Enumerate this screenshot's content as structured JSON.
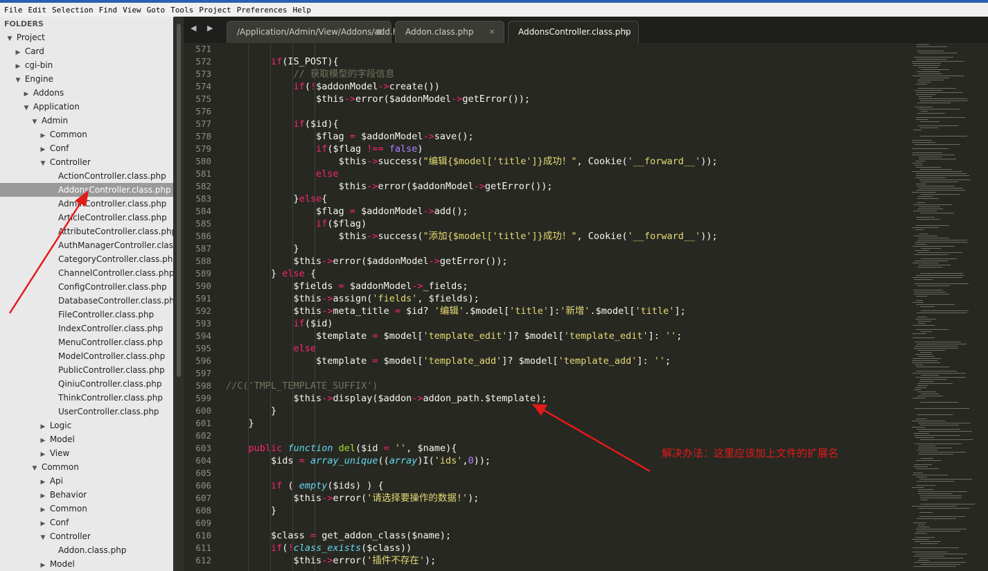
{
  "menu": [
    "File",
    "Edit",
    "Selection",
    "Find",
    "View",
    "Goto",
    "Tools",
    "Project",
    "Preferences",
    "Help"
  ],
  "sidebar": {
    "header": "FOLDERS",
    "tree": [
      {
        "label": "Project",
        "depth": 0,
        "open": true
      },
      {
        "label": "Card",
        "depth": 1,
        "open": false
      },
      {
        "label": "cgi-bin",
        "depth": 1,
        "open": false
      },
      {
        "label": "Engine",
        "depth": 1,
        "open": true
      },
      {
        "label": "Addons",
        "depth": 2,
        "open": false
      },
      {
        "label": "Application",
        "depth": 2,
        "open": true
      },
      {
        "label": "Admin",
        "depth": 3,
        "open": true
      },
      {
        "label": "Common",
        "depth": 4,
        "open": false
      },
      {
        "label": "Conf",
        "depth": 4,
        "open": false
      },
      {
        "label": "Controller",
        "depth": 4,
        "open": true
      },
      {
        "label": "ActionController.class.php",
        "depth": 5,
        "file": true
      },
      {
        "label": "AddonsController.class.php",
        "depth": 5,
        "file": true,
        "selected": true
      },
      {
        "label": "AdminController.class.php",
        "depth": 5,
        "file": true
      },
      {
        "label": "ArticleController.class.php",
        "depth": 5,
        "file": true
      },
      {
        "label": "AttributeController.class.php",
        "depth": 5,
        "file": true
      },
      {
        "label": "AuthManagerController.class.php",
        "depth": 5,
        "file": true
      },
      {
        "label": "CategoryController.class.php",
        "depth": 5,
        "file": true
      },
      {
        "label": "ChannelController.class.php",
        "depth": 5,
        "file": true
      },
      {
        "label": "ConfigController.class.php",
        "depth": 5,
        "file": true
      },
      {
        "label": "DatabaseController.class.php",
        "depth": 5,
        "file": true
      },
      {
        "label": "FileController.class.php",
        "depth": 5,
        "file": true
      },
      {
        "label": "IndexController.class.php",
        "depth": 5,
        "file": true
      },
      {
        "label": "MenuController.class.php",
        "depth": 5,
        "file": true
      },
      {
        "label": "ModelController.class.php",
        "depth": 5,
        "file": true
      },
      {
        "label": "PublicController.class.php",
        "depth": 5,
        "file": true
      },
      {
        "label": "QiniuController.class.php",
        "depth": 5,
        "file": true
      },
      {
        "label": "ThinkController.class.php",
        "depth": 5,
        "file": true
      },
      {
        "label": "UserController.class.php",
        "depth": 5,
        "file": true
      },
      {
        "label": "Logic",
        "depth": 4,
        "open": false
      },
      {
        "label": "Model",
        "depth": 4,
        "open": false
      },
      {
        "label": "View",
        "depth": 4,
        "open": false
      },
      {
        "label": "Common",
        "depth": 3,
        "open": true
      },
      {
        "label": "Api",
        "depth": 4,
        "open": false
      },
      {
        "label": "Behavior",
        "depth": 4,
        "open": false
      },
      {
        "label": "Common",
        "depth": 4,
        "open": false
      },
      {
        "label": "Conf",
        "depth": 4,
        "open": false
      },
      {
        "label": "Controller",
        "depth": 4,
        "open": true
      },
      {
        "label": "Addon.class.php",
        "depth": 5,
        "file": true
      },
      {
        "label": "Model",
        "depth": 4,
        "open": false
      }
    ]
  },
  "tabs": [
    {
      "label": "/Application/Admin/View/Addons/add.html",
      "marker": "●",
      "active": false
    },
    {
      "label": "Addon.class.php",
      "marker": "×",
      "active": false
    },
    {
      "label": "AddonsController.class.php",
      "marker": "×",
      "active": true
    }
  ],
  "nav_arrows": "◀ ▶",
  "colors": {
    "keyword": "#f92672",
    "string": "#e6db74",
    "func": "#66d9ef",
    "call": "#a6e22e",
    "comment": "#75715e",
    "number": "#ae81ff",
    "plain": "#f8f8f2",
    "annotation": "#e21a1a"
  },
  "code": [
    {
      "n": "571",
      "t": []
    },
    {
      "n": "572",
      "t": [
        [
          "        ",
          "p"
        ],
        [
          "if",
          "k"
        ],
        [
          "(IS_POST){",
          "p"
        ]
      ]
    },
    {
      "n": "573",
      "t": [
        [
          "            ",
          "p"
        ],
        [
          "// 获取模型的字段信息",
          "c"
        ]
      ]
    },
    {
      "n": "574",
      "t": [
        [
          "            ",
          "p"
        ],
        [
          "if",
          "k"
        ],
        [
          "(",
          "p"
        ],
        [
          "!",
          "k"
        ],
        [
          "$addonModel",
          "p"
        ],
        [
          "->",
          "k"
        ],
        [
          "create",
          "p"
        ],
        [
          "())",
          "p"
        ]
      ]
    },
    {
      "n": "575",
      "t": [
        [
          "                ",
          "p"
        ],
        [
          "$this",
          "p"
        ],
        [
          "->",
          "k"
        ],
        [
          "error",
          "p"
        ],
        [
          "($addonModel",
          "p"
        ],
        [
          "->",
          "k"
        ],
        [
          "getError",
          "p"
        ],
        [
          "());",
          "p"
        ]
      ]
    },
    {
      "n": "576",
      "t": []
    },
    {
      "n": "577",
      "t": [
        [
          "            ",
          "p"
        ],
        [
          "if",
          "k"
        ],
        [
          "($id){",
          "p"
        ]
      ]
    },
    {
      "n": "578",
      "t": [
        [
          "                ",
          "p"
        ],
        [
          "$flag ",
          "p"
        ],
        [
          "=",
          "k"
        ],
        [
          " $addonModel",
          "p"
        ],
        [
          "->",
          "k"
        ],
        [
          "save",
          "p"
        ],
        [
          "();",
          "p"
        ]
      ]
    },
    {
      "n": "579",
      "t": [
        [
          "                ",
          "p"
        ],
        [
          "if",
          "k"
        ],
        [
          "($flag ",
          "p"
        ],
        [
          "!==",
          "k"
        ],
        [
          " ",
          "p"
        ],
        [
          "false",
          "n"
        ],
        [
          ")",
          "p"
        ]
      ]
    },
    {
      "n": "580",
      "t": [
        [
          "                    ",
          "p"
        ],
        [
          "$this",
          "p"
        ],
        [
          "->",
          "k"
        ],
        [
          "success",
          "p"
        ],
        [
          "(",
          "p"
        ],
        [
          "\"编辑{$model['title']}成功！\"",
          "s"
        ],
        [
          ", Cookie(",
          "p"
        ],
        [
          "'__forward__'",
          "s"
        ],
        [
          "));",
          "p"
        ]
      ]
    },
    {
      "n": "581",
      "t": [
        [
          "                ",
          "p"
        ],
        [
          "else",
          "k"
        ]
      ]
    },
    {
      "n": "582",
      "t": [
        [
          "                    ",
          "p"
        ],
        [
          "$this",
          "p"
        ],
        [
          "->",
          "k"
        ],
        [
          "error",
          "p"
        ],
        [
          "($addonModel",
          "p"
        ],
        [
          "->",
          "k"
        ],
        [
          "getError",
          "p"
        ],
        [
          "());",
          "p"
        ]
      ]
    },
    {
      "n": "583",
      "t": [
        [
          "            ",
          "p"
        ],
        [
          "}",
          "p"
        ],
        [
          "else",
          "k"
        ],
        [
          "{",
          "p"
        ]
      ]
    },
    {
      "n": "584",
      "t": [
        [
          "                ",
          "p"
        ],
        [
          "$flag ",
          "p"
        ],
        [
          "=",
          "k"
        ],
        [
          " $addonModel",
          "p"
        ],
        [
          "->",
          "k"
        ],
        [
          "add",
          "p"
        ],
        [
          "();",
          "p"
        ]
      ]
    },
    {
      "n": "585",
      "t": [
        [
          "                ",
          "p"
        ],
        [
          "if",
          "k"
        ],
        [
          "($flag)",
          "p"
        ]
      ]
    },
    {
      "n": "586",
      "t": [
        [
          "                    ",
          "p"
        ],
        [
          "$this",
          "p"
        ],
        [
          "->",
          "k"
        ],
        [
          "success",
          "p"
        ],
        [
          "(",
          "p"
        ],
        [
          "\"添加{$model['title']}成功！\"",
          "s"
        ],
        [
          ", Cookie(",
          "p"
        ],
        [
          "'__forward__'",
          "s"
        ],
        [
          "));",
          "p"
        ]
      ]
    },
    {
      "n": "587",
      "t": [
        [
          "            ",
          "p"
        ],
        [
          "}",
          "p"
        ]
      ]
    },
    {
      "n": "588",
      "t": [
        [
          "            ",
          "p"
        ],
        [
          "$this",
          "p"
        ],
        [
          "->",
          "k"
        ],
        [
          "error",
          "p"
        ],
        [
          "($addonModel",
          "p"
        ],
        [
          "->",
          "k"
        ],
        [
          "getError",
          "p"
        ],
        [
          "());",
          "p"
        ]
      ]
    },
    {
      "n": "589",
      "t": [
        [
          "        ",
          "p"
        ],
        [
          "} ",
          "p"
        ],
        [
          "else",
          "k"
        ],
        [
          " {",
          "p"
        ]
      ]
    },
    {
      "n": "590",
      "t": [
        [
          "            ",
          "p"
        ],
        [
          "$fields ",
          "p"
        ],
        [
          "=",
          "k"
        ],
        [
          " $addonModel",
          "p"
        ],
        [
          "->",
          "k"
        ],
        [
          "_fields;",
          "p"
        ]
      ]
    },
    {
      "n": "591",
      "t": [
        [
          "            ",
          "p"
        ],
        [
          "$this",
          "p"
        ],
        [
          "->",
          "k"
        ],
        [
          "assign(",
          "p"
        ],
        [
          "'fields'",
          "s"
        ],
        [
          ", $fields);",
          "p"
        ]
      ]
    },
    {
      "n": "592",
      "t": [
        [
          "            ",
          "p"
        ],
        [
          "$this",
          "p"
        ],
        [
          "->",
          "k"
        ],
        [
          "meta_title ",
          "p"
        ],
        [
          "=",
          "k"
        ],
        [
          " $id? ",
          "p"
        ],
        [
          "'编辑'",
          "s"
        ],
        [
          ".$model[",
          "p"
        ],
        [
          "'title'",
          "s"
        ],
        [
          "]:",
          "p"
        ],
        [
          "'新增'",
          "s"
        ],
        [
          ".$model[",
          "p"
        ],
        [
          "'title'",
          "s"
        ],
        [
          "];",
          "p"
        ]
      ]
    },
    {
      "n": "593",
      "t": [
        [
          "            ",
          "p"
        ],
        [
          "if",
          "k"
        ],
        [
          "($id)",
          "p"
        ]
      ]
    },
    {
      "n": "594",
      "t": [
        [
          "                ",
          "p"
        ],
        [
          "$template ",
          "p"
        ],
        [
          "=",
          "k"
        ],
        [
          " $model[",
          "p"
        ],
        [
          "'template_edit'",
          "s"
        ],
        [
          "]? $model[",
          "p"
        ],
        [
          "'template_edit'",
          "s"
        ],
        [
          "]: ",
          "p"
        ],
        [
          "''",
          "s"
        ],
        [
          ";",
          "p"
        ]
      ]
    },
    {
      "n": "595",
      "t": [
        [
          "            ",
          "p"
        ],
        [
          "else",
          "k"
        ]
      ]
    },
    {
      "n": "596",
      "t": [
        [
          "                ",
          "p"
        ],
        [
          "$template ",
          "p"
        ],
        [
          "=",
          "k"
        ],
        [
          " $model[",
          "p"
        ],
        [
          "'template_add'",
          "s"
        ],
        [
          "]? $model[",
          "p"
        ],
        [
          "'template_add'",
          "s"
        ],
        [
          "]: ",
          "p"
        ],
        [
          "''",
          "s"
        ],
        [
          ";",
          "p"
        ]
      ]
    },
    {
      "n": "597",
      "t": []
    },
    {
      "n": "598",
      "t": [
        [
          "//C('TMPL_TEMPLATE_SUFFIX')",
          "c"
        ]
      ]
    },
    {
      "n": "599",
      "t": [
        [
          "            ",
          "p"
        ],
        [
          "$this",
          "p"
        ],
        [
          "->",
          "k"
        ],
        [
          "display($addon",
          "p"
        ],
        [
          "->",
          "k"
        ],
        [
          "addon_path.$template);",
          "p"
        ]
      ]
    },
    {
      "n": "600",
      "t": [
        [
          "        ",
          "p"
        ],
        [
          "}",
          "p"
        ]
      ]
    },
    {
      "n": "601",
      "t": [
        [
          "    ",
          "p"
        ],
        [
          "}",
          "p"
        ]
      ]
    },
    {
      "n": "602",
      "t": []
    },
    {
      "n": "603",
      "t": [
        [
          "    ",
          "p"
        ],
        [
          "public",
          "k"
        ],
        [
          " ",
          "p"
        ],
        [
          "function",
          "f"
        ],
        [
          " ",
          "p"
        ],
        [
          "del",
          "a"
        ],
        [
          "($id ",
          "p"
        ],
        [
          "=",
          "k"
        ],
        [
          " ",
          "p"
        ],
        [
          "''",
          "s"
        ],
        [
          ", $name){",
          "p"
        ]
      ]
    },
    {
      "n": "604",
      "t": [
        [
          "        ",
          "p"
        ],
        [
          "$ids ",
          "p"
        ],
        [
          "=",
          "k"
        ],
        [
          " ",
          "p"
        ],
        [
          "array_unique",
          "f"
        ],
        [
          "((",
          "p"
        ],
        [
          "array",
          "f"
        ],
        [
          ")I(",
          "p"
        ],
        [
          "'ids'",
          "s"
        ],
        [
          ",",
          "p"
        ],
        [
          "0",
          "n"
        ],
        [
          "));",
          "p"
        ]
      ]
    },
    {
      "n": "605",
      "t": []
    },
    {
      "n": "606",
      "t": [
        [
          "        ",
          "p"
        ],
        [
          "if",
          "k"
        ],
        [
          " ( ",
          "p"
        ],
        [
          "empty",
          "f"
        ],
        [
          "($ids) ) {",
          "p"
        ]
      ]
    },
    {
      "n": "607",
      "t": [
        [
          "            ",
          "p"
        ],
        [
          "$this",
          "p"
        ],
        [
          "->",
          "k"
        ],
        [
          "error(",
          "p"
        ],
        [
          "'请选择要操作的数据!'",
          "s"
        ],
        [
          ");",
          "p"
        ]
      ]
    },
    {
      "n": "608",
      "t": [
        [
          "        ",
          "p"
        ],
        [
          "}",
          "p"
        ]
      ]
    },
    {
      "n": "609",
      "t": []
    },
    {
      "n": "610",
      "t": [
        [
          "        ",
          "p"
        ],
        [
          "$class ",
          "p"
        ],
        [
          "=",
          "k"
        ],
        [
          " get_addon_class($name);",
          "p"
        ]
      ]
    },
    {
      "n": "611",
      "t": [
        [
          "        ",
          "p"
        ],
        [
          "if",
          "k"
        ],
        [
          "(",
          "p"
        ],
        [
          "!",
          "k"
        ],
        [
          "class_exists",
          "f"
        ],
        [
          "($class))",
          "p"
        ]
      ]
    },
    {
      "n": "612",
      "t": [
        [
          "            ",
          "p"
        ],
        [
          "$this",
          "p"
        ],
        [
          "->",
          "k"
        ],
        [
          "error(",
          "p"
        ],
        [
          "'插件不存在'",
          "s"
        ],
        [
          ");",
          "p"
        ]
      ]
    }
  ],
  "annotation": "解决办法：这里应该加上文件的扩展名"
}
